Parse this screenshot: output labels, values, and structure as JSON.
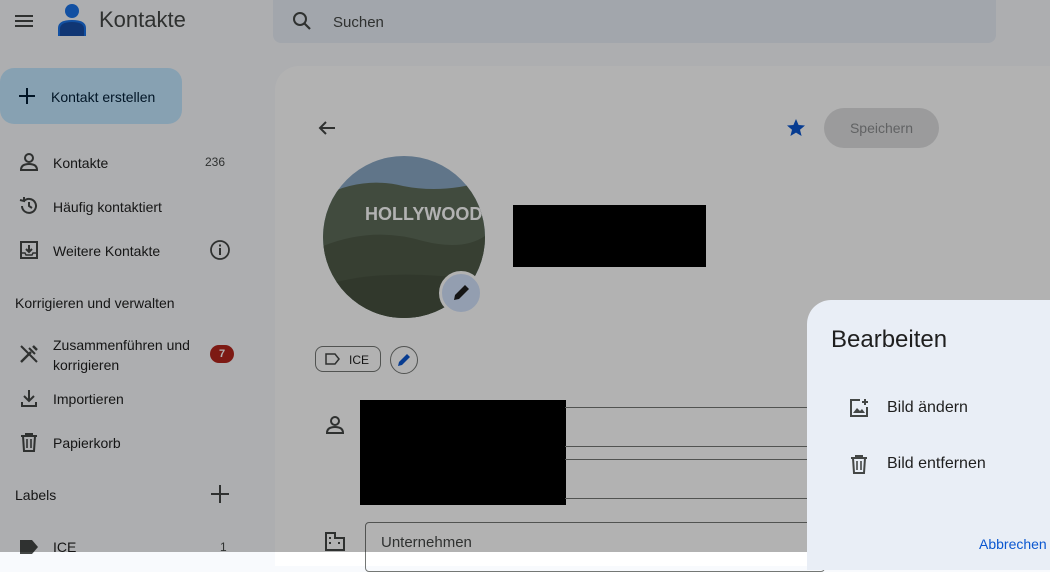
{
  "app": {
    "title": "Kontakte"
  },
  "search": {
    "placeholder": "Suchen"
  },
  "sidebar": {
    "create_label": "Kontakt erstellen",
    "items": [
      {
        "label": "Kontakte",
        "count": "236"
      },
      {
        "label": "Häufig kontaktiert"
      },
      {
        "label": "Weitere Kontakte"
      }
    ],
    "manage_heading": "Korrigieren und verwalten",
    "manage_items": [
      {
        "label_line1": "Zusammenführen und",
        "label_line2": "korrigieren",
        "badge": "7"
      },
      {
        "label": "Importieren"
      },
      {
        "label": "Papierkorb"
      }
    ],
    "labels_heading": "Labels",
    "labels": [
      {
        "label": "ICE",
        "count": "1"
      }
    ]
  },
  "contact": {
    "save_label": "Speichern",
    "photo_text": "HOLLYWOOD",
    "label_chip": "ICE",
    "company_placeholder": "Unternehmen"
  },
  "dialog": {
    "title": "Bearbeiten",
    "change_label": "Bild ändern",
    "remove_label": "Bild entfernen",
    "cancel_label": "Abbrechen"
  },
  "colors": {
    "accent": "#0b57d0",
    "create_bg": "#c2e7ff",
    "badge": "#b3261e",
    "star": "#0b57d0"
  }
}
